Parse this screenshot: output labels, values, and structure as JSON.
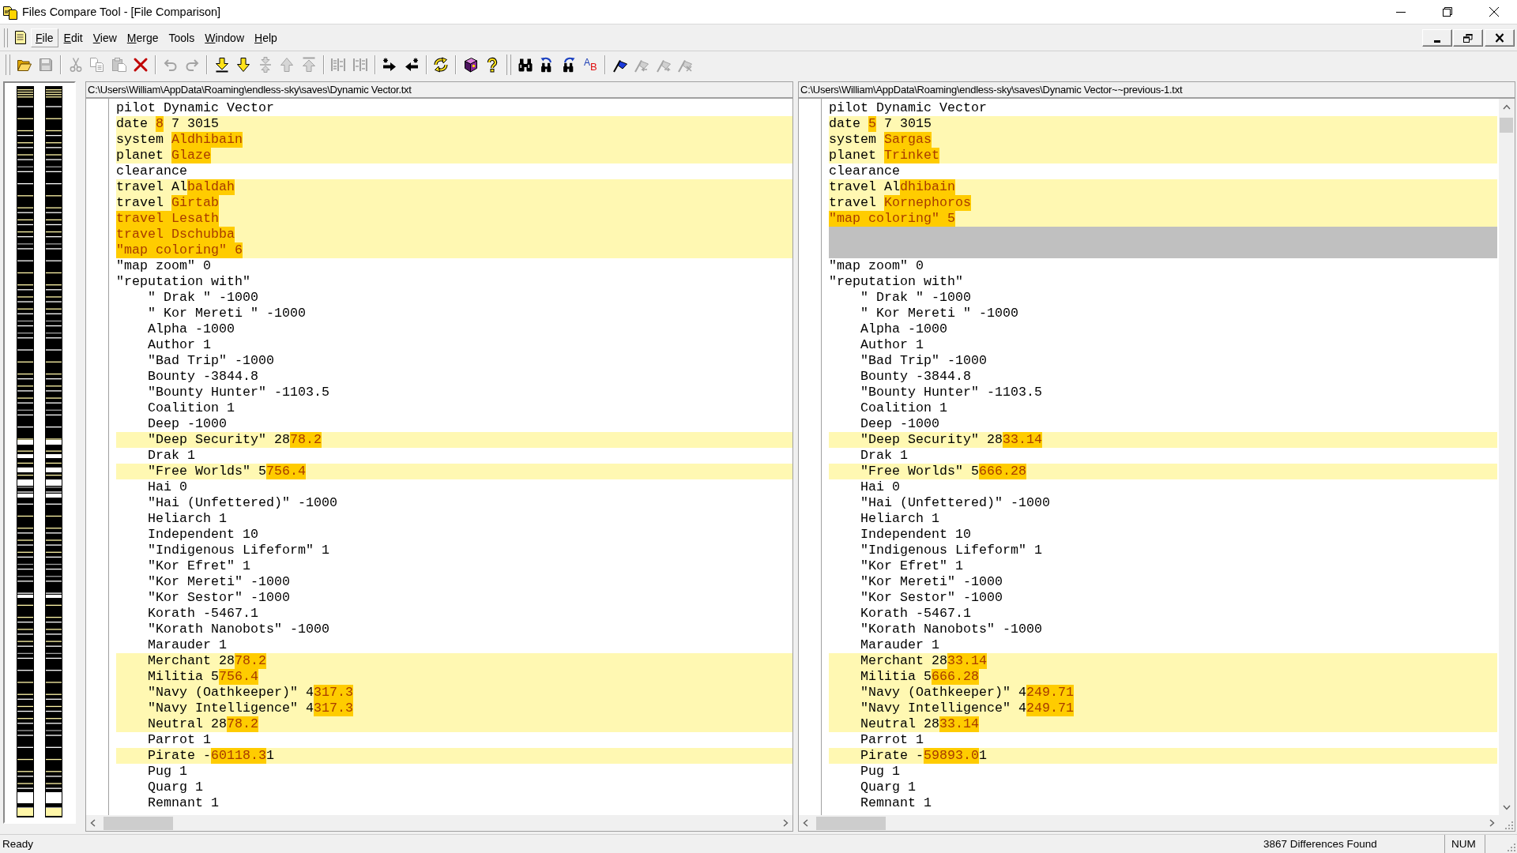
{
  "window": {
    "title": "Files Compare Tool - [File Comparison]"
  },
  "menu": [
    {
      "label": "File",
      "selected": true,
      "mnemonic": true
    },
    {
      "label": "Edit",
      "selected": false,
      "mnemonic": true
    },
    {
      "label": "View",
      "selected": false,
      "mnemonic": true
    },
    {
      "label": "Merge",
      "selected": false,
      "mnemonic": true
    },
    {
      "label": "Tools",
      "selected": false,
      "mnemonic": false
    },
    {
      "label": "Window",
      "selected": false,
      "mnemonic": true
    },
    {
      "label": "Help",
      "selected": false,
      "mnemonic": true
    }
  ],
  "toolbars": [
    {
      "groups": [
        {
          "buttons": [
            {
              "kind": "open",
              "disabled": false
            },
            {
              "kind": "save",
              "disabled": true
            }
          ]
        },
        {
          "buttons": [
            {
              "kind": "cut",
              "disabled": true
            },
            {
              "kind": "copy",
              "disabled": true
            },
            {
              "kind": "paste",
              "disabled": true
            },
            {
              "kind": "delete",
              "disabled": false
            }
          ]
        },
        {
          "buttons": [
            {
              "kind": "undo",
              "disabled": true
            },
            {
              "kind": "redo",
              "disabled": true
            }
          ]
        },
        {
          "buttons": [
            {
              "kind": "last",
              "disabled": false
            },
            {
              "kind": "next",
              "disabled": false
            },
            {
              "kind": "current",
              "disabled": true
            },
            {
              "kind": "previous",
              "disabled": true
            },
            {
              "kind": "first",
              "disabled": true
            }
          ]
        },
        {
          "buttons": [
            {
              "kind": "mergeleft",
              "disabled": true
            },
            {
              "kind": "mergeright",
              "disabled": true
            }
          ]
        },
        {
          "buttons": [
            {
              "kind": "copyright",
              "disabled": false
            },
            {
              "kind": "copyleft",
              "disabled": false
            }
          ]
        },
        {
          "buttons": [
            {
              "kind": "refresh",
              "disabled": false
            }
          ]
        },
        {
          "buttons": [
            {
              "kind": "manual",
              "disabled": false
            },
            {
              "kind": "help",
              "disabled": false
            }
          ]
        }
      ]
    },
    {
      "groups": [
        {
          "buttons": [
            {
              "kind": "find",
              "disabled": false
            },
            {
              "kind": "findprevious",
              "disabled": false
            },
            {
              "kind": "findnext",
              "disabled": false
            },
            {
              "kind": "letters",
              "disabled": false,
              "letters": [
                "A",
                "B"
              ]
            }
          ]
        },
        {
          "buttons": [
            {
              "kind": "bookmark",
              "disabled": false
            },
            {
              "kind": "bookmarkprevious",
              "disabled": true
            },
            {
              "kind": "bookmarknext",
              "disabled": true
            },
            {
              "kind": "bookmarkclear",
              "disabled": true
            }
          ]
        }
      ]
    }
  ],
  "panes": [
    {
      "path": "C:\\Users\\William\\AppData\\Roaming\\endless-sky\\saves\\Dynamic Vector.txt",
      "lines": [
        {
          "kind": "text",
          "changed": false,
          "text": "pilot Dynamic Vector"
        },
        {
          "kind": "text",
          "changed": true,
          "parts": [
            {
              "text": "date ",
              "diff": false
            },
            {
              "text": "8",
              "diff": true
            },
            {
              "text": " 7 3015",
              "diff": false
            }
          ]
        },
        {
          "kind": "text",
          "changed": true,
          "parts": [
            {
              "text": "system ",
              "diff": false
            },
            {
              "text": "Aldhibain",
              "diff": true
            }
          ]
        },
        {
          "kind": "text",
          "changed": true,
          "parts": [
            {
              "text": "planet ",
              "diff": false
            },
            {
              "text": "Glaze",
              "diff": true
            }
          ]
        },
        {
          "kind": "text",
          "changed": false,
          "text": "clearance"
        },
        {
          "kind": "text",
          "changed": true,
          "parts": [
            {
              "text": "travel Al",
              "diff": false
            },
            {
              "text": "baldah",
              "diff": true
            }
          ]
        },
        {
          "kind": "text",
          "changed": true,
          "parts": [
            {
              "text": "travel ",
              "diff": false
            },
            {
              "text": "Girtab",
              "diff": true
            }
          ]
        },
        {
          "kind": "text",
          "changed": true,
          "parts": [
            {
              "text": "travel Lesath",
              "diff": true
            }
          ]
        },
        {
          "kind": "text",
          "changed": true,
          "parts": [
            {
              "text": "travel Dschubba",
              "diff": true
            }
          ]
        },
        {
          "kind": "text",
          "changed": true,
          "parts": [
            {
              "text": "\"map coloring\" 6",
              "diff": true
            }
          ]
        },
        {
          "kind": "text",
          "changed": false,
          "text": "\"map zoom\" 0"
        },
        {
          "kind": "text",
          "changed": false,
          "text": "\"reputation with\"",
          "children": [
            {
              "kind": "text",
              "changed": false,
              "text": "\" Drak \" -1000"
            },
            {
              "kind": "text",
              "changed": false,
              "text": "\" Kor Mereti \" -1000"
            },
            {
              "kind": "text",
              "changed": false,
              "text": "Alpha -1000"
            },
            {
              "kind": "text",
              "changed": false,
              "text": "Author 1"
            },
            {
              "kind": "text",
              "changed": false,
              "text": "\"Bad Trip\" -1000"
            },
            {
              "kind": "text",
              "changed": false,
              "text": "Bounty -3844.8"
            },
            {
              "kind": "text",
              "changed": false,
              "text": "\"Bounty Hunter\" -1103.5"
            },
            {
              "kind": "text",
              "changed": false,
              "text": "Coalition 1"
            },
            {
              "kind": "text",
              "changed": false,
              "text": "Deep -1000"
            },
            {
              "kind": "text",
              "changed": true,
              "parts": [
                {
                  "text": "\"Deep Security\" 28",
                  "diff": false
                },
                {
                  "text": "78.2",
                  "diff": true
                }
              ]
            },
            {
              "kind": "text",
              "changed": false,
              "text": "Drak 1"
            },
            {
              "kind": "text",
              "changed": true,
              "parts": [
                {
                  "text": "\"Free Worlds\" 5",
                  "diff": false
                },
                {
                  "text": "756.4",
                  "diff": true
                }
              ]
            },
            {
              "kind": "text",
              "changed": false,
              "text": "Hai 0"
            },
            {
              "kind": "text",
              "changed": false,
              "text": "\"Hai (Unfettered)\" -1000"
            },
            {
              "kind": "text",
              "changed": false,
              "text": "Heliarch 1"
            },
            {
              "kind": "text",
              "changed": false,
              "text": "Independent 10"
            },
            {
              "kind": "text",
              "changed": false,
              "text": "\"Indigenous Lifeform\" 1"
            },
            {
              "kind": "text",
              "changed": false,
              "text": "\"Kor Efret\" 1"
            },
            {
              "kind": "text",
              "changed": false,
              "text": "\"Kor Mereti\" -1000"
            },
            {
              "kind": "text",
              "changed": false,
              "text": "\"Kor Sestor\" -1000"
            },
            {
              "kind": "text",
              "changed": false,
              "text": "Korath -5467.1"
            },
            {
              "kind": "text",
              "changed": false,
              "text": "\"Korath Nanobots\" -1000"
            },
            {
              "kind": "text",
              "changed": false,
              "text": "Marauder 1"
            },
            {
              "kind": "text",
              "changed": true,
              "parts": [
                {
                  "text": "Merchant 28",
                  "diff": false
                },
                {
                  "text": "78.2",
                  "diff": true
                }
              ]
            },
            {
              "kind": "text",
              "changed": true,
              "parts": [
                {
                  "text": "Militia 5",
                  "diff": false
                },
                {
                  "text": "756.4",
                  "diff": true
                }
              ]
            },
            {
              "kind": "text",
              "changed": true,
              "parts": [
                {
                  "text": "\"Navy (Oathkeeper)\" 4",
                  "diff": false
                },
                {
                  "text": "317.3",
                  "diff": true
                }
              ]
            },
            {
              "kind": "text",
              "changed": true,
              "parts": [
                {
                  "text": "\"Navy Intelligence\" 4",
                  "diff": false
                },
                {
                  "text": "317.3",
                  "diff": true
                }
              ]
            },
            {
              "kind": "text",
              "changed": true,
              "parts": [
                {
                  "text": "Neutral 28",
                  "diff": false
                },
                {
                  "text": "78.2",
                  "diff": true
                }
              ]
            },
            {
              "kind": "text",
              "changed": false,
              "text": "Parrot 1"
            },
            {
              "kind": "text",
              "changed": true,
              "parts": [
                {
                  "text": "Pirate -",
                  "diff": false
                },
                {
                  "text": "60118.3",
                  "diff": true
                },
                {
                  "text": "1",
                  "diff": false
                }
              ]
            },
            {
              "kind": "text",
              "changed": false,
              "text": "Pug 1"
            },
            {
              "kind": "text",
              "changed": false,
              "text": "Quarg 1"
            },
            {
              "kind": "text",
              "changed": false,
              "text": "Remnant 1"
            }
          ]
        }
      ]
    },
    {
      "path": "C:\\Users\\William\\AppData\\Roaming\\endless-sky\\saves\\Dynamic Vector~~previous-1.txt",
      "lines": [
        {
          "kind": "text",
          "changed": false,
          "text": "pilot Dynamic Vector"
        },
        {
          "kind": "text",
          "changed": true,
          "parts": [
            {
              "text": "date ",
              "diff": false
            },
            {
              "text": "5",
              "diff": true
            },
            {
              "text": " 7 3015",
              "diff": false
            }
          ]
        },
        {
          "kind": "text",
          "changed": true,
          "parts": [
            {
              "text": "system ",
              "diff": false
            },
            {
              "text": "Sargas",
              "diff": true
            }
          ]
        },
        {
          "kind": "text",
          "changed": true,
          "parts": [
            {
              "text": "planet ",
              "diff": false
            },
            {
              "text": "Trinket",
              "diff": true
            }
          ]
        },
        {
          "kind": "text",
          "changed": false,
          "text": "clearance"
        },
        {
          "kind": "text",
          "changed": true,
          "parts": [
            {
              "text": "travel Al",
              "diff": false
            },
            {
              "text": "dhibain",
              "diff": true
            }
          ]
        },
        {
          "kind": "text",
          "changed": true,
          "parts": [
            {
              "text": "travel ",
              "diff": false
            },
            {
              "text": "Kornephoros",
              "diff": true
            }
          ]
        },
        {
          "kind": "text",
          "changed": true,
          "parts": [
            {
              "text": "\"map coloring\" 5",
              "diff": true
            }
          ]
        },
        {
          "kind": "gap"
        },
        {
          "kind": "gap"
        },
        {
          "kind": "text",
          "changed": false,
          "text": "\"map zoom\" 0"
        },
        {
          "kind": "text",
          "changed": false,
          "text": "\"reputation with\"",
          "children": [
            {
              "kind": "text",
              "changed": false,
              "text": "\" Drak \" -1000"
            },
            {
              "kind": "text",
              "changed": false,
              "text": "\" Kor Mereti \" -1000"
            },
            {
              "kind": "text",
              "changed": false,
              "text": "Alpha -1000"
            },
            {
              "kind": "text",
              "changed": false,
              "text": "Author 1"
            },
            {
              "kind": "text",
              "changed": false,
              "text": "\"Bad Trip\" -1000"
            },
            {
              "kind": "text",
              "changed": false,
              "text": "Bounty -3844.8"
            },
            {
              "kind": "text",
              "changed": false,
              "text": "\"Bounty Hunter\" -1103.5"
            },
            {
              "kind": "text",
              "changed": false,
              "text": "Coalition 1"
            },
            {
              "kind": "text",
              "changed": false,
              "text": "Deep -1000"
            },
            {
              "kind": "text",
              "changed": true,
              "parts": [
                {
                  "text": "\"Deep Security\" 28",
                  "diff": false
                },
                {
                  "text": "33.14",
                  "diff": true
                }
              ]
            },
            {
              "kind": "text",
              "changed": false,
              "text": "Drak 1"
            },
            {
              "kind": "text",
              "changed": true,
              "parts": [
                {
                  "text": "\"Free Worlds\" 5",
                  "diff": false
                },
                {
                  "text": "666.28",
                  "diff": true
                }
              ]
            },
            {
              "kind": "text",
              "changed": false,
              "text": "Hai 0"
            },
            {
              "kind": "text",
              "changed": false,
              "text": "\"Hai (Unfettered)\" -1000"
            },
            {
              "kind": "text",
              "changed": false,
              "text": "Heliarch 1"
            },
            {
              "kind": "text",
              "changed": false,
              "text": "Independent 10"
            },
            {
              "kind": "text",
              "changed": false,
              "text": "\"Indigenous Lifeform\" 1"
            },
            {
              "kind": "text",
              "changed": false,
              "text": "\"Kor Efret\" 1"
            },
            {
              "kind": "text",
              "changed": false,
              "text": "\"Kor Mereti\" -1000"
            },
            {
              "kind": "text",
              "changed": false,
              "text": "\"Kor Sestor\" -1000"
            },
            {
              "kind": "text",
              "changed": false,
              "text": "Korath -5467.1"
            },
            {
              "kind": "text",
              "changed": false,
              "text": "\"Korath Nanobots\" -1000"
            },
            {
              "kind": "text",
              "changed": false,
              "text": "Marauder 1"
            },
            {
              "kind": "text",
              "changed": true,
              "parts": [
                {
                  "text": "Merchant 28",
                  "diff": false
                },
                {
                  "text": "33.14",
                  "diff": true
                }
              ]
            },
            {
              "kind": "text",
              "changed": true,
              "parts": [
                {
                  "text": "Militia 5",
                  "diff": false
                },
                {
                  "text": "666.28",
                  "diff": true
                }
              ]
            },
            {
              "kind": "text",
              "changed": true,
              "parts": [
                {
                  "text": "\"Navy (Oathkeeper)\" 4",
                  "diff": false
                },
                {
                  "text": "249.71",
                  "diff": true
                }
              ]
            },
            {
              "kind": "text",
              "changed": true,
              "parts": [
                {
                  "text": "\"Navy Intelligence\" 4",
                  "diff": false
                },
                {
                  "text": "249.71",
                  "diff": true
                }
              ]
            },
            {
              "kind": "text",
              "changed": true,
              "parts": [
                {
                  "text": "Neutral 28",
                  "diff": false
                },
                {
                  "text": "33.14",
                  "diff": true
                }
              ]
            },
            {
              "kind": "text",
              "changed": false,
              "text": "Parrot 1"
            },
            {
              "kind": "text",
              "changed": true,
              "parts": [
                {
                  "text": "Pirate -",
                  "diff": false
                },
                {
                  "text": "59893.0",
                  "diff": true
                },
                {
                  "text": "1",
                  "diff": false
                }
              ]
            },
            {
              "kind": "text",
              "changed": false,
              "text": "Pug 1"
            },
            {
              "kind": "text",
              "changed": false,
              "text": "Quarg 1"
            },
            {
              "kind": "text",
              "changed": false,
              "text": "Remnant 1"
            }
          ]
        }
      ]
    }
  ],
  "status_bar": {
    "message": "Ready",
    "differences": "3867 Differences Found",
    "keyboard": "NUM"
  }
}
